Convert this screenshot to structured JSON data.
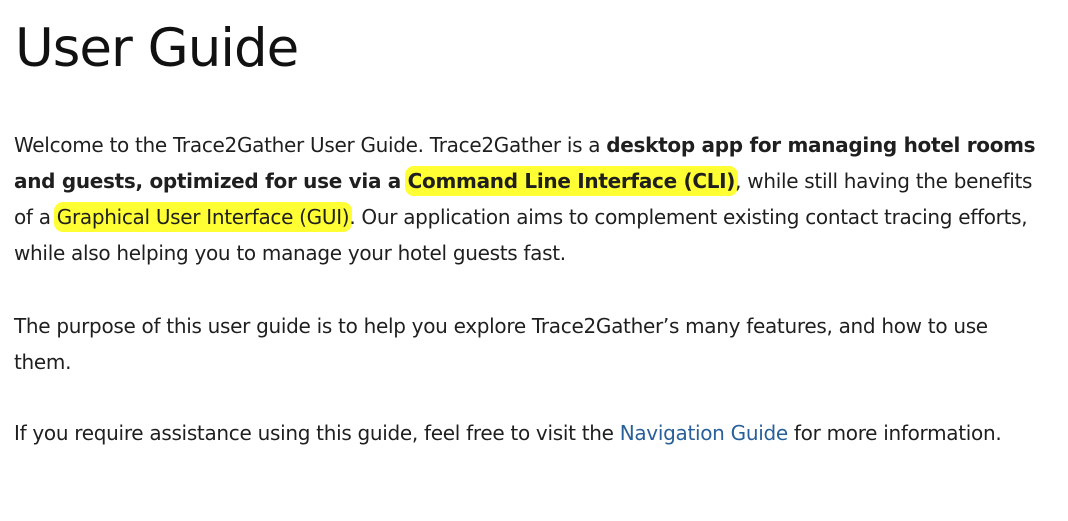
{
  "page_title": "User Guide",
  "intro": {
    "t1": "Welcome to the Trace2Gather User Guide. Trace2Gather is a ",
    "b1": "desktop app for managing hotel rooms and guests, optimized for use via a ",
    "b2_highlight": "Command Line Interface (CLI)",
    "t2": ", while still having the benefits of a ",
    "h1": "Graphical User Interface (GUI)",
    "t3": ". Our application aims to complement existing contact tracing efforts, while also helping you to manage your hotel guests fast."
  },
  "purpose": {
    "text": "The purpose of this user guide is to help you explore Trace2Gather’s many features, and how to use them."
  },
  "assistance": {
    "before": "If you require assistance using this guide, feel free to visit the ",
    "link": "Navigation Guide",
    "after": " for more information."
  },
  "colors": {
    "highlight": "#ffff33",
    "link": "#2a6099",
    "text": "#1f1f1f"
  }
}
